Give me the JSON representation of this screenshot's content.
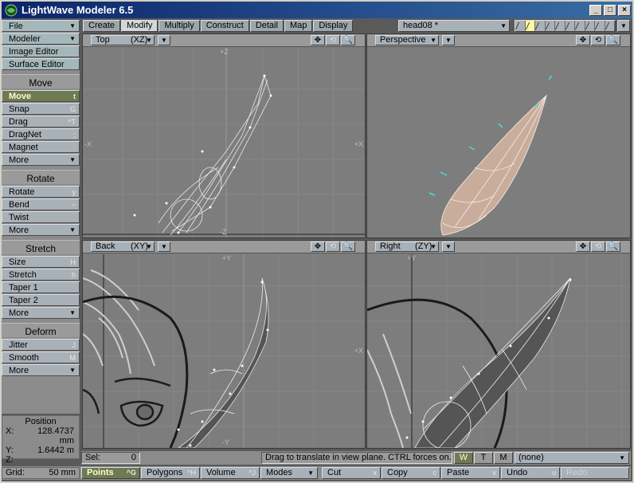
{
  "window": {
    "title": "LightWave Modeler 6.5",
    "controls": [
      "_",
      "□",
      "×"
    ]
  },
  "sidebar": {
    "top_menus": [
      {
        "label": "File"
      },
      {
        "label": "Modeler"
      },
      {
        "label": "Image Editor"
      },
      {
        "label": "Surface Editor"
      }
    ],
    "groups": [
      {
        "heading": "Move",
        "items": [
          {
            "label": "Move",
            "shortcut": "t",
            "active": true
          },
          {
            "label": "Snap",
            "shortcut": "G"
          },
          {
            "label": "Drag",
            "shortcut": "^T"
          },
          {
            "label": "DragNet",
            "shortcut": ";"
          },
          {
            "label": "Magnet",
            "shortcut": ":"
          },
          {
            "label": "More",
            "more": true
          }
        ]
      },
      {
        "heading": "Rotate",
        "items": [
          {
            "label": "Rotate",
            "shortcut": "y"
          },
          {
            "label": "Bend",
            "shortcut": "~"
          },
          {
            "label": "Twist",
            "shortcut": ""
          },
          {
            "label": "More",
            "more": true
          }
        ]
      },
      {
        "heading": "Stretch",
        "items": [
          {
            "label": "Size",
            "shortcut": "H"
          },
          {
            "label": "Stretch",
            "shortcut": "h"
          },
          {
            "label": "Taper 1",
            "shortcut": ""
          },
          {
            "label": "Taper 2",
            "shortcut": ""
          },
          {
            "label": "More",
            "more": true
          }
        ]
      },
      {
        "heading": "Deform",
        "items": [
          {
            "label": "Jitter",
            "shortcut": "J"
          },
          {
            "label": "Smooth",
            "shortcut": "M"
          },
          {
            "label": "More",
            "more": true
          }
        ]
      }
    ]
  },
  "position": {
    "heading": "Position",
    "x_label": "X:",
    "x_value": "128.4737 mm",
    "y_label": "Y:",
    "y_value": "1.6442 m",
    "z_label": "Z:",
    "z_value": ""
  },
  "tabs": [
    {
      "label": "Create"
    },
    {
      "label": "Modify",
      "selected": true
    },
    {
      "label": "Multiply"
    },
    {
      "label": "Construct"
    },
    {
      "label": "Detail"
    },
    {
      "label": "Map"
    },
    {
      "label": "Display"
    }
  ],
  "object": {
    "current": "head08 *"
  },
  "viewports": [
    {
      "name": "Top",
      "axes": "(XZ)",
      "labels": {
        "top": "+Z",
        "left": "-X",
        "right": "+X",
        "bottom": "-Z"
      }
    },
    {
      "name": "Perspective",
      "axes": "",
      "labels": {}
    },
    {
      "name": "Back",
      "axes": "(XY)",
      "labels": {
        "top": "+Y",
        "left": "",
        "right": "+X",
        "bottom": "-Y"
      }
    },
    {
      "name": "Right",
      "axes": "(ZY)",
      "labels": {
        "top": "+Y",
        "left": "",
        "right": "",
        "bottom": ""
      }
    }
  ],
  "status": {
    "sel_label": "Sel:",
    "sel_value": "0",
    "hint": "Drag to translate in view plane. CTRL forces on...",
    "wtm": [
      "W",
      "T",
      "M"
    ],
    "surface": "(none)"
  },
  "command_bar": {
    "grid_label": "Grid:",
    "grid_value": "50 mm",
    "points": {
      "label": "Points",
      "shortcut": "^G"
    },
    "polygons": {
      "label": "Polygons",
      "shortcut": "^H"
    },
    "volume": {
      "label": "Volume",
      "shortcut": "^J"
    },
    "modes": {
      "label": "Modes"
    },
    "cut": {
      "label": "Cut",
      "shortcut": "x"
    },
    "copy": {
      "label": "Copy",
      "shortcut": "c"
    },
    "paste": {
      "label": "Paste",
      "shortcut": "v"
    },
    "undo": {
      "label": "Undo",
      "shortcut": "u"
    },
    "redo": {
      "label": "Redo"
    }
  },
  "colors": {
    "active_button": "#6e7a52",
    "viewport_bg": "#7d7d7d",
    "ear_surface": "#c9ad9c",
    "vertex_marker": "#40e0e0"
  }
}
